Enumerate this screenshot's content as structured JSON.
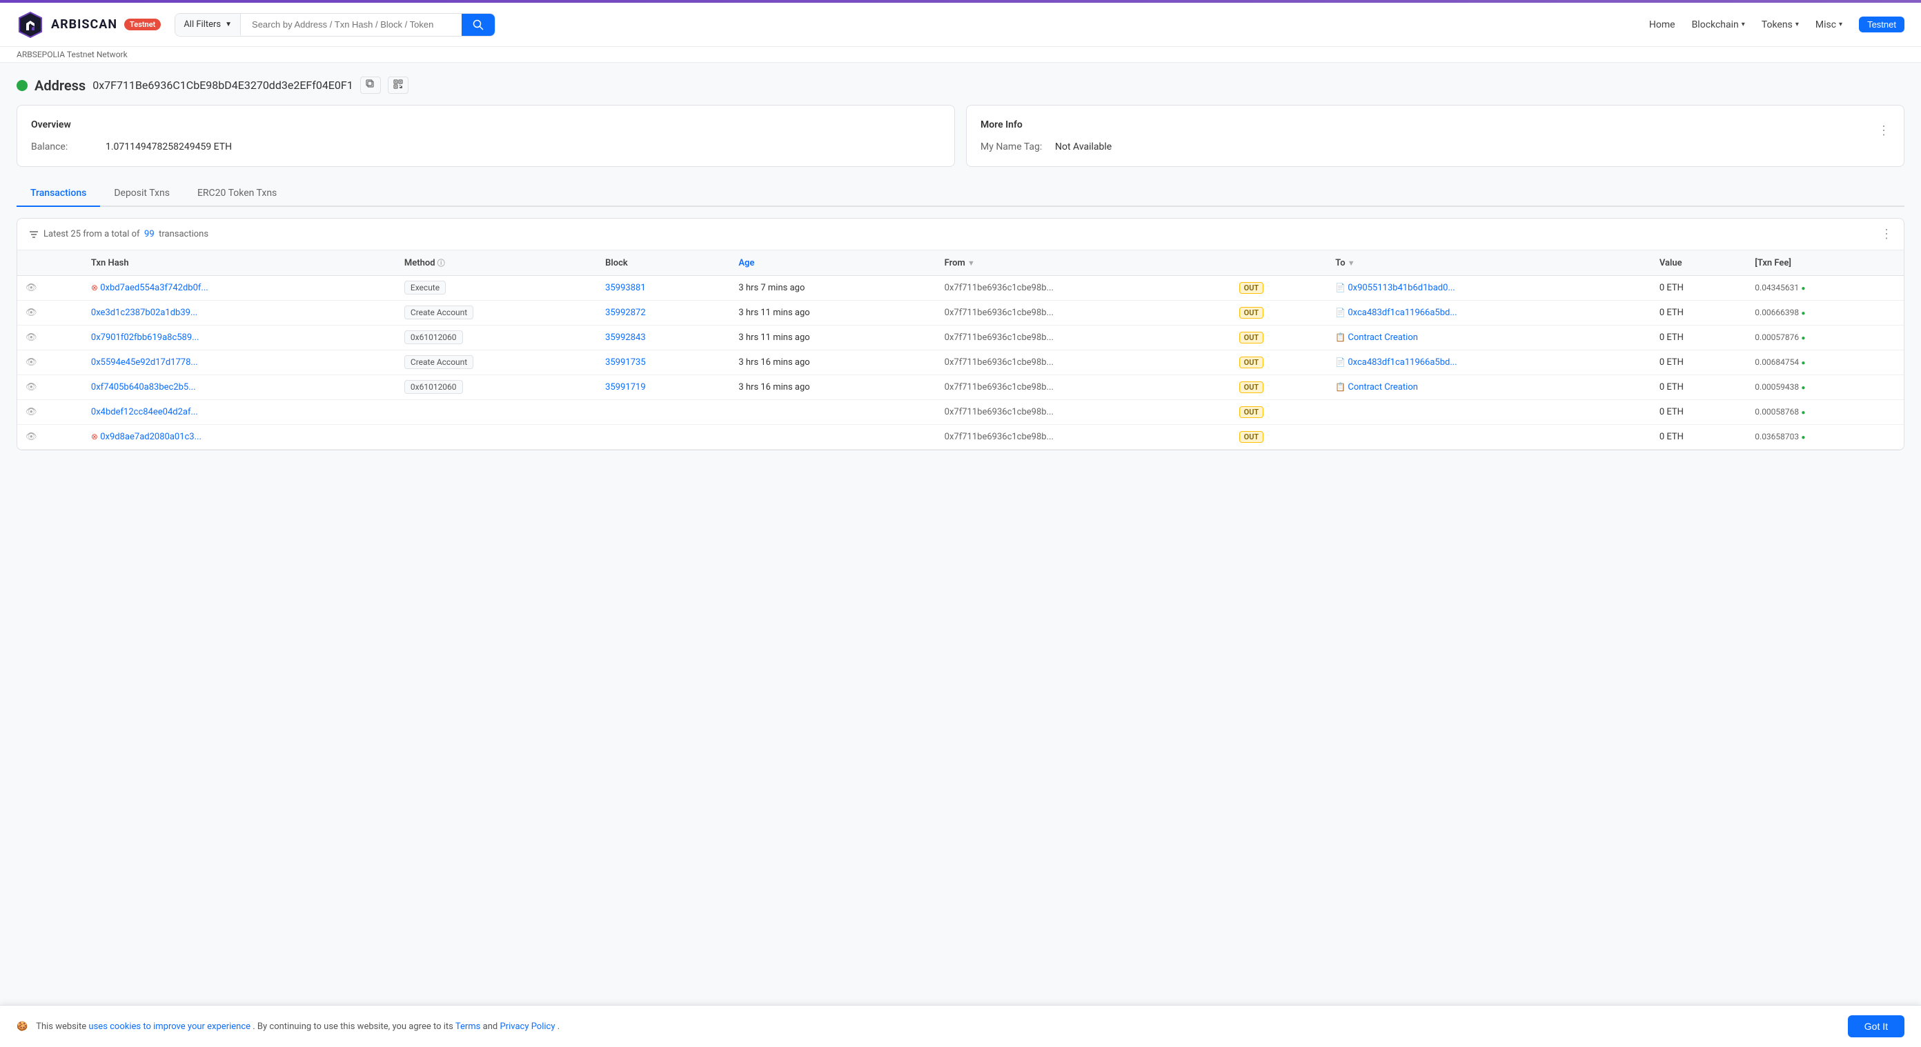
{
  "topbar": {},
  "header": {
    "logo_text": "ARBISCAN",
    "testnet_label": "Testnet",
    "network_label": "ARBSEPOLIA Testnet Network",
    "filter_label": "All Filters",
    "search_placeholder": "Search by Address / Txn Hash / Block / Token",
    "nav": {
      "home": "Home",
      "blockchain": "Blockchain",
      "tokens": "Tokens",
      "misc": "Misc",
      "testnet_btn": "Testnet"
    }
  },
  "address": {
    "label": "Address",
    "value": "0x7F711Be6936C1CbE98bD4E3270dd3e2EFf04E0F1",
    "copy_title": "Copy",
    "qr_title": "QR Code"
  },
  "overview": {
    "title": "Overview",
    "balance_label": "Balance:",
    "balance_value": "1.071149478258249459 ETH",
    "more_info_title": "More Info",
    "name_tag_label": "My Name Tag:",
    "name_tag_value": "Not Available"
  },
  "tabs": {
    "transactions": "Transactions",
    "deposit_txns": "Deposit Txns",
    "erc20_txns": "ERC20 Token Txns"
  },
  "txn_list": {
    "summary": "Latest 25 from a total of",
    "total": "99",
    "suffix": "transactions",
    "columns": {
      "txn_hash": "Txn Hash",
      "method": "Method",
      "block": "Block",
      "age": "Age",
      "from": "From",
      "to": "To",
      "value": "Value",
      "txn_fee": "[Txn Fee]"
    },
    "rows": [
      {
        "error": true,
        "hash": "0xbd7aed554a3f742db0f...",
        "method": "Execute",
        "method_raw": null,
        "block": "35993881",
        "age": "3 hrs 7 mins ago",
        "from": "0x7f711be6936c1cbe98b...",
        "direction": "OUT",
        "to_type": "address",
        "to": "0x9055113b41b6d1bad0...",
        "value": "0 ETH",
        "fee": "0.04345631"
      },
      {
        "error": false,
        "hash": "0xe3d1c2387b02a1db39...",
        "method": "Create Account",
        "method_raw": null,
        "block": "35992872",
        "age": "3 hrs 11 mins ago",
        "from": "0x7f711be6936c1cbe98b...",
        "direction": "OUT",
        "to_type": "address",
        "to": "0xca483df1ca11966a5bd...",
        "value": "0 ETH",
        "fee": "0.00666398"
      },
      {
        "error": false,
        "hash": "0x7901f02fbb619a8c589...",
        "method": "0x61012060",
        "method_raw": true,
        "block": "35992843",
        "age": "3 hrs 11 mins ago",
        "from": "0x7f711be6936c1cbe98b...",
        "direction": "OUT",
        "to_type": "contract_creation",
        "to": "Contract Creation",
        "value": "0 ETH",
        "fee": "0.00057876"
      },
      {
        "error": false,
        "hash": "0x5594e45e92d17d1778...",
        "method": "Create Account",
        "method_raw": null,
        "block": "35991735",
        "age": "3 hrs 16 mins ago",
        "from": "0x7f711be6936c1cbe98b...",
        "direction": "OUT",
        "to_type": "address",
        "to": "0xca483df1ca11966a5bd...",
        "value": "0 ETH",
        "fee": "0.00684754"
      },
      {
        "error": false,
        "hash": "0xf7405b640a83bec2b5...",
        "method": "0x61012060",
        "method_raw": true,
        "block": "35991719",
        "age": "3 hrs 16 mins ago",
        "from": "0x7f711be6936c1cbe98b...",
        "direction": "OUT",
        "to_type": "contract_creation",
        "to": "Contract Creation",
        "value": "0 ETH",
        "fee": "0.00059438"
      },
      {
        "error": false,
        "hash": "0x4bdef12cc84ee04d2af...",
        "method": "",
        "method_raw": null,
        "block": "",
        "age": "",
        "from": "0x7f711be6936c1cbe98b...",
        "direction": "OUT",
        "to_type": "address",
        "to": "",
        "value": "0 ETH",
        "fee": "0.00058768"
      },
      {
        "error": true,
        "hash": "0x9d8ae7ad2080a01c3...",
        "method": "",
        "method_raw": null,
        "block": "",
        "age": "",
        "from": "0x7f711be6936c1cbe98b...",
        "direction": "OUT",
        "to_type": "address",
        "to": "",
        "value": "0 ETH",
        "fee": "0.03658703"
      }
    ]
  },
  "cookie": {
    "text_before": "This website",
    "link_text": "uses cookies to improve your experience",
    "text_middle": ". By continuing to use this website, you agree to its",
    "terms_text": "Terms",
    "text_and": "and",
    "privacy_text": "Privacy Policy",
    "text_end": ".",
    "button_label": "Got It",
    "cookie_icon": "🍪"
  }
}
